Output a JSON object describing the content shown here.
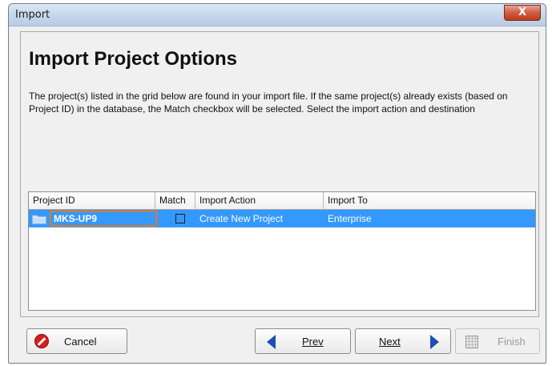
{
  "window": {
    "title": "Import",
    "close_label": "X"
  },
  "page": {
    "heading": "Import Project Options",
    "description": "The project(s) listed in the grid below are found in your import file. If the same project(s) already exists (based on Project ID) in the database, the Match checkbox will be selected.  Select the import action and destination"
  },
  "grid": {
    "columns": [
      "Project ID",
      "Match",
      "Import Action",
      "Import To"
    ],
    "rows": [
      {
        "project_id": "MKS-UP9",
        "match": false,
        "import_action": "Create New Project",
        "import_to": "Enterprise",
        "icon": "folder-icon",
        "selected": true
      }
    ]
  },
  "buttons": {
    "cancel": "Cancel",
    "prev": "Prev",
    "next": "Next",
    "finish": "Finish"
  },
  "colors": {
    "selection": "#3399ff",
    "focus_border": "#e0792a",
    "nav_arrow": "#1e4fb5",
    "cancel_icon": "#d71e1e"
  }
}
